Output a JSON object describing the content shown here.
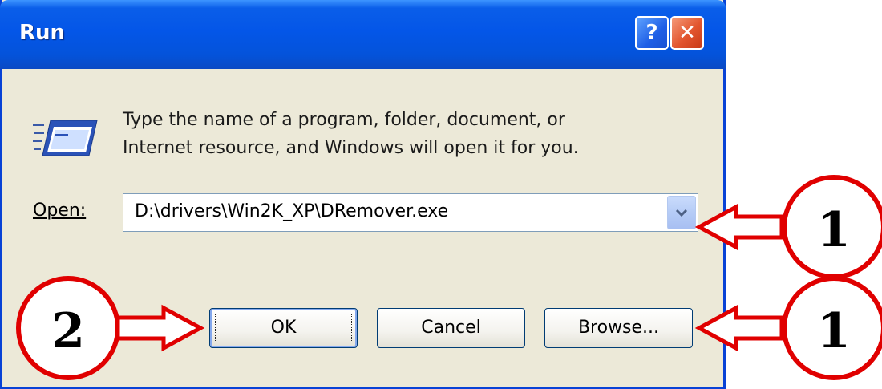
{
  "window": {
    "title": "Run",
    "help_glyph": "?",
    "close_glyph": "✕"
  },
  "dialog": {
    "description_line1": "Type the name of a program, folder, document, or",
    "description_line2": "Internet resource, and Windows will open it for you.",
    "open_label": "Open:",
    "open_value": "D:\\drivers\\Win2K_XP\\DRemover.exe",
    "icon": "run-icon"
  },
  "buttons": {
    "ok": "OK",
    "cancel": "Cancel",
    "browse": "Browse..."
  },
  "annotations": {
    "marker_combo": "1",
    "marker_browse": "1",
    "marker_ok": "2",
    "color": "#e00000"
  }
}
